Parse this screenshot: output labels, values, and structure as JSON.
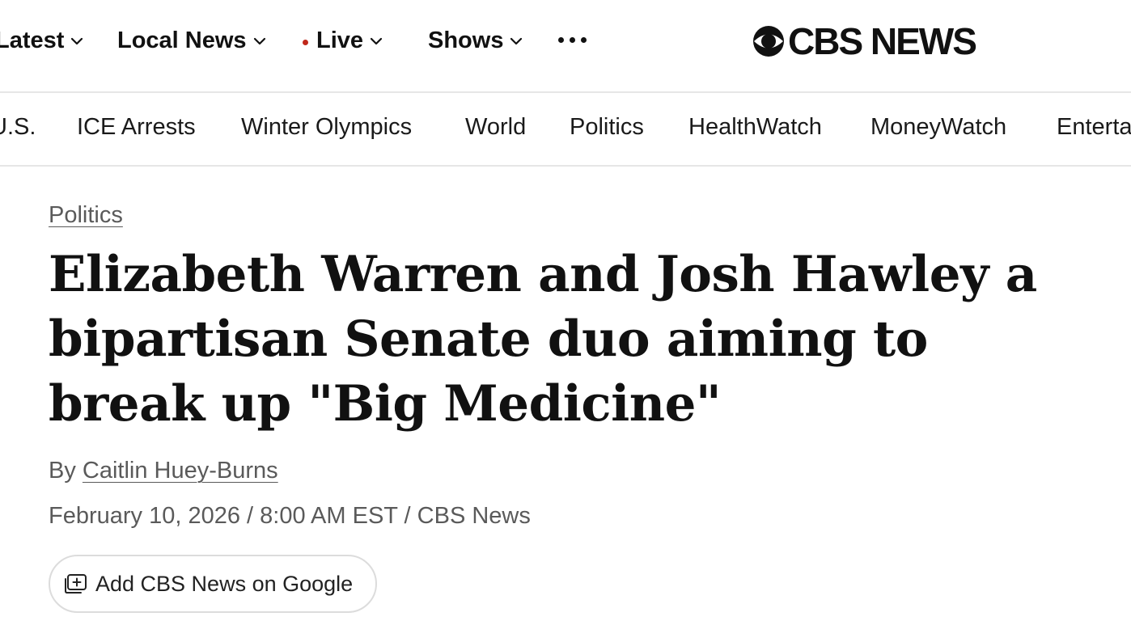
{
  "top_nav": {
    "items": [
      {
        "label": "Latest"
      },
      {
        "label": "Local News"
      },
      {
        "label": "Live"
      },
      {
        "label": "Shows"
      }
    ],
    "more_icon": "ellipsis-icon",
    "brand": "CBS NEWS",
    "live_dot_color": "#c0281b"
  },
  "sub_nav": {
    "items": [
      {
        "label": "U.S."
      },
      {
        "label": "ICE Arrests"
      },
      {
        "label": "Winter Olympics"
      },
      {
        "label": "World"
      },
      {
        "label": "Politics"
      },
      {
        "label": "HealthWatch"
      },
      {
        "label": "MoneyWatch"
      },
      {
        "label": "Entertainment"
      }
    ]
  },
  "article": {
    "category": "Politics",
    "headline": "Elizabeth Warren and Josh Hawley a bipartisan Senate duo aiming to break up \"Big Medicine\"",
    "byline_prefix": "By",
    "author": "Caitlin Huey-Burns",
    "dateline": "February 10, 2026 / 8:00 AM EST / CBS News",
    "google_button": "Add CBS News on Google"
  }
}
